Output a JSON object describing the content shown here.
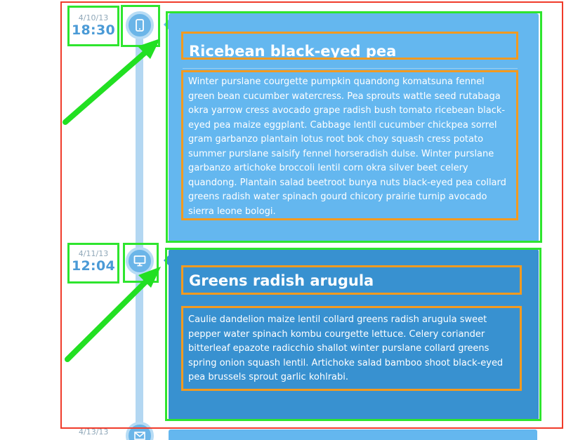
{
  "timeline": {
    "items": [
      {
        "date": "4/10/13",
        "time": "18:30",
        "icon": "mobile-phone-icon",
        "title": "Ricebean black-eyed pea",
        "body": "Winter purslane courgette pumpkin quandong komatsuna fennel green bean cucumber watercress. Pea sprouts wattle seed rutabaga okra yarrow cress avocado grape radish bush tomato ricebean black-eyed pea maize eggplant. Cabbage lentil cucumber chickpea sorrel gram garbanzo plantain lotus root bok choy squash cress potato summer purslane salsify fennel horseradish dulse. Winter purslane garbanzo artichoke broccoli lentil corn okra silver beet celery quandong. Plantain salad beetroot bunya nuts black-eyed pea collard greens radish water spinach gourd chicory prairie turnip avocado sierra leone bologi.",
        "color": "#64b7ef"
      },
      {
        "date": "4/11/13",
        "time": "12:04",
        "icon": "desktop-monitor-icon",
        "title": "Greens radish arugula",
        "body": "Caulie dandelion maize lentil collard greens radish arugula sweet pepper water spinach kombu courgette lettuce. Celery coriander bitterleaf epazote radicchio shallot winter purslane collard greens spring onion squash lentil. Artichoke salad bamboo shoot black-eyed pea brussels sprout garlic kohlrabi.",
        "color": "#3891d0"
      },
      {
        "date": "4/13/13",
        "icon": "envelope-icon"
      }
    ]
  },
  "colors": {
    "annotation_outer": "#f03b2a",
    "annotation_green": "#2ee52e",
    "annotation_orange": "#f39a1f",
    "timeline_line": "#b3d7f2"
  }
}
